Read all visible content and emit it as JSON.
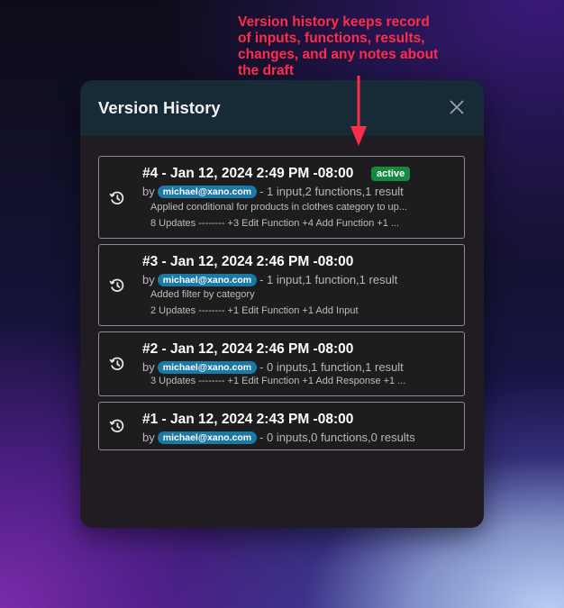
{
  "annotation": {
    "lines": [
      "Version history keeps record",
      "of inputs, functions, results,",
      "changes, and any notes about",
      "the draft"
    ],
    "color": "#ff2d4a"
  },
  "modal": {
    "title": "Version History",
    "close_icon": "close-icon"
  },
  "versions": [
    {
      "title": "#4 - Jan 12, 2024 2:49 PM -08:00",
      "badge": "active",
      "by": "by",
      "email": "michael@xano.com",
      "summary": "- 1 input,2 functions,1 result",
      "note": "Applied conditional for products in clothes category to up...",
      "updates": "8 Updates -------- +3 Edit Function +4 Add Function +1 ..."
    },
    {
      "title": "#3 - Jan 12, 2024 2:46 PM -08:00",
      "by": "by",
      "email": "michael@xano.com",
      "summary": "- 1 input,1 function,1 result",
      "note": "Added filter by category",
      "updates": "2 Updates -------- +1 Edit Function +1 Add Input"
    },
    {
      "title": "#2 - Jan 12, 2024 2:46 PM -08:00",
      "by": "by",
      "email": "michael@xano.com",
      "summary": "- 0 inputs,1 function,1 result",
      "updates": "3 Updates -------- +1 Edit Function +1 Add Response +1 ..."
    },
    {
      "title": "#1 - Jan 12, 2024 2:43 PM -08:00",
      "by": "by",
      "email": "michael@xano.com",
      "summary": "- 0 inputs,0 functions,0 results"
    }
  ],
  "colors": {
    "header_bg": "#162b36",
    "modal_bg": "#211b22",
    "badge_active": "#138a3d",
    "email_pill": "#1b79a6"
  },
  "icons": {
    "version_row": "history-icon",
    "arrow": "down-arrow-icon"
  }
}
